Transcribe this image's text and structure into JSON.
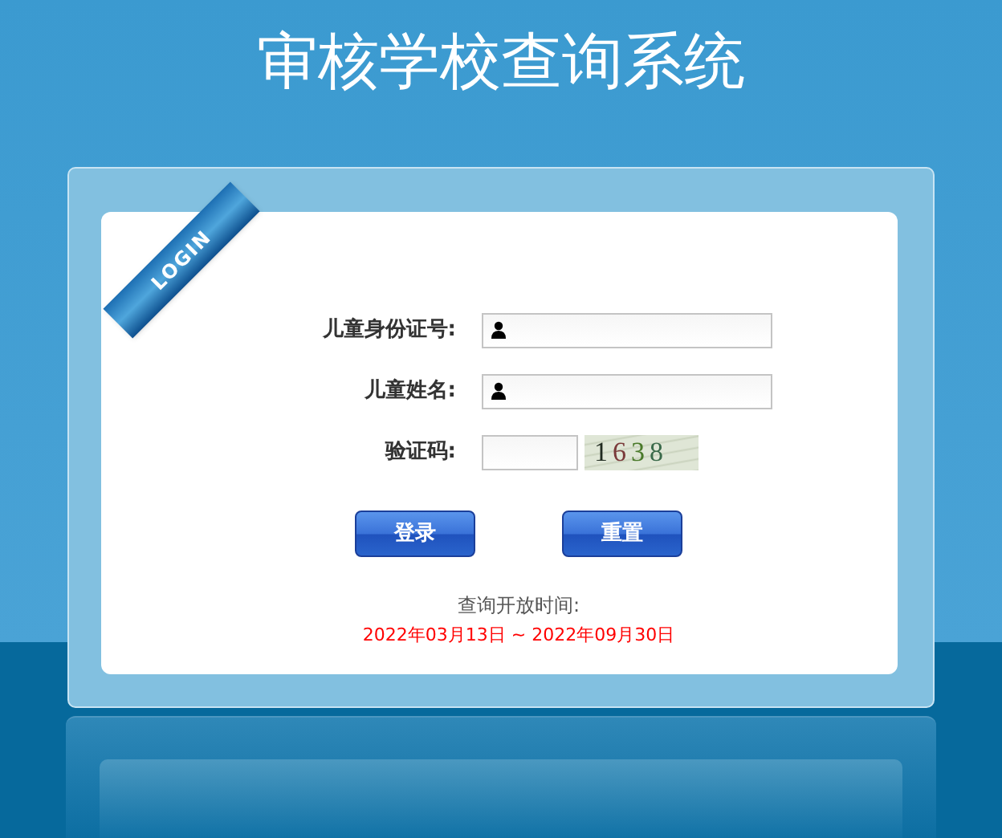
{
  "title": "审核学校查询系统",
  "ribbon": "LOGIN",
  "fields": [
    {
      "kind": "text",
      "label": "儿童身份证号:"
    },
    {
      "kind": "text",
      "label": "儿童姓名:"
    },
    {
      "kind": "captcha",
      "label": "验证码:",
      "code": "1638"
    }
  ],
  "buttons": [
    "登录",
    "重置"
  ],
  "open_time": {
    "label": "查询开放时间:",
    "range": "2022年03月13日 ~ 2022年09月30日"
  }
}
